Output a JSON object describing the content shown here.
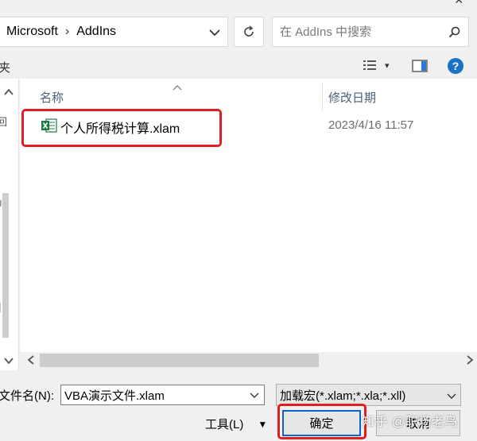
{
  "window": {
    "close_glyph": "×"
  },
  "address_bar": {
    "crumbs": [
      "Microsoft",
      "AddIns"
    ],
    "separator": "›",
    "dropdown_icon": "chevron-down-icon",
    "refresh_icon": "refresh-icon"
  },
  "search": {
    "placeholder": "在 AddIns 中搜索",
    "icon": "search-icon"
  },
  "toolbar": {
    "left_fragment": "夹",
    "view_icon": "view-options-icon",
    "view_dropdown": "▾",
    "preview_pane_icon": "preview-pane-icon",
    "help_label": "?"
  },
  "nav": {
    "glyphs": [
      "回",
      "╯",
      "】"
    ]
  },
  "file_list": {
    "columns": [
      "名称",
      "修改日期"
    ],
    "rows": [
      {
        "name": "个人所得税计算.xlam",
        "modified": "2023/4/16 11:57",
        "icon": "excel-addin-icon"
      }
    ]
  },
  "bottom": {
    "filename_label": "文件名(N):",
    "filename_value": "VBA演示文件.xlam",
    "filter_value": "加载宏(*.xlam;*.xla;*.xll)",
    "tools_label": "工具(L)",
    "tools_dropdown": "▼",
    "ok_label": "确定",
    "cancel_label": "取消",
    "watermark": "知乎 @职场老鸟"
  },
  "colors": {
    "highlight": "#e02020",
    "accent": "#0a64c8",
    "excel_green": "#1d7a45"
  }
}
